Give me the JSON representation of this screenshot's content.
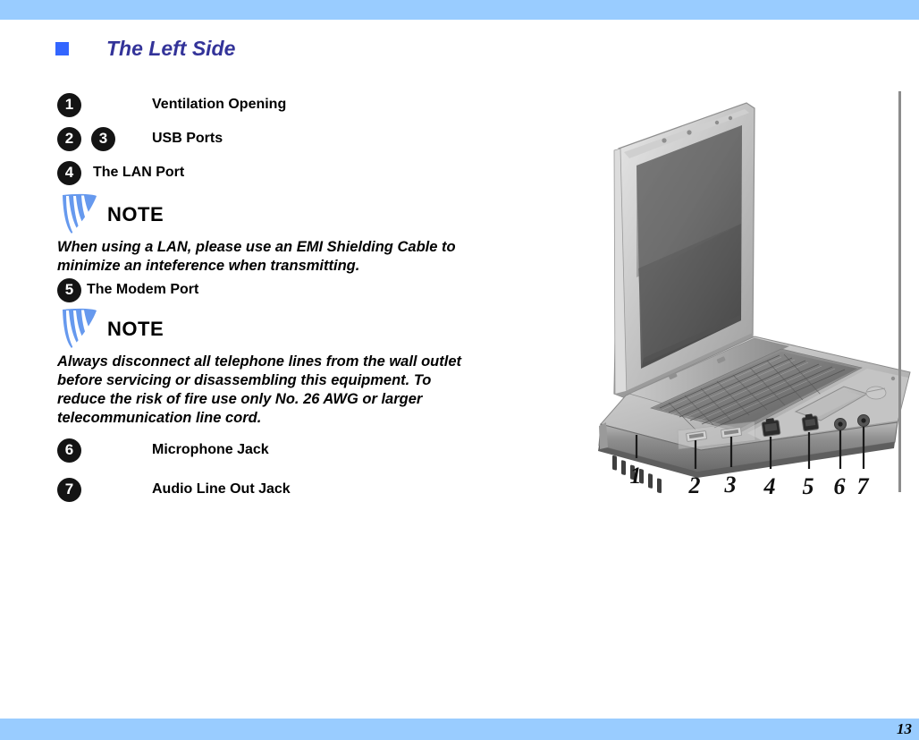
{
  "page": {
    "number": "13",
    "header_band_color": "#99ccff",
    "footer_band_color": "#99ccff",
    "background_color": "#ffffff"
  },
  "section": {
    "bullet_icon": "square-bullet-icon",
    "bullet_color": "#3366ff",
    "title": "The Left Side",
    "title_color": "#333399"
  },
  "items": [
    {
      "numbers": [
        "1"
      ],
      "label": "Ventilation Opening"
    },
    {
      "numbers": [
        "2",
        "3"
      ],
      "label": "USB Ports"
    },
    {
      "numbers": [
        "4"
      ],
      "label": "The LAN Port"
    },
    {
      "numbers": [
        "5"
      ],
      "label": "The Modem Port"
    },
    {
      "numbers": [
        "6"
      ],
      "label": "Microphone Jack"
    },
    {
      "numbers": [
        "7"
      ],
      "label": "Audio Line Out Jack"
    }
  ],
  "notes": [
    {
      "icon": "note-feather-icon",
      "heading": "NOTE",
      "body": "When using a LAN, please use an EMI Shielding Cable to minimize an inteference when transmitting."
    },
    {
      "icon": "note-feather-icon",
      "heading": "NOTE",
      "body": "Always disconnect all telephone lines from the wall outlet before servicing or disassembling this equipment. To reduce the risk of fire use only No. 26 AWG or larger telecommunication line cord."
    }
  ],
  "figure": {
    "description": "Open notebook computer viewed from the front-left showing the left-side ports",
    "callouts": [
      "1",
      "2",
      "3",
      "4",
      "5",
      "6",
      "7"
    ]
  }
}
